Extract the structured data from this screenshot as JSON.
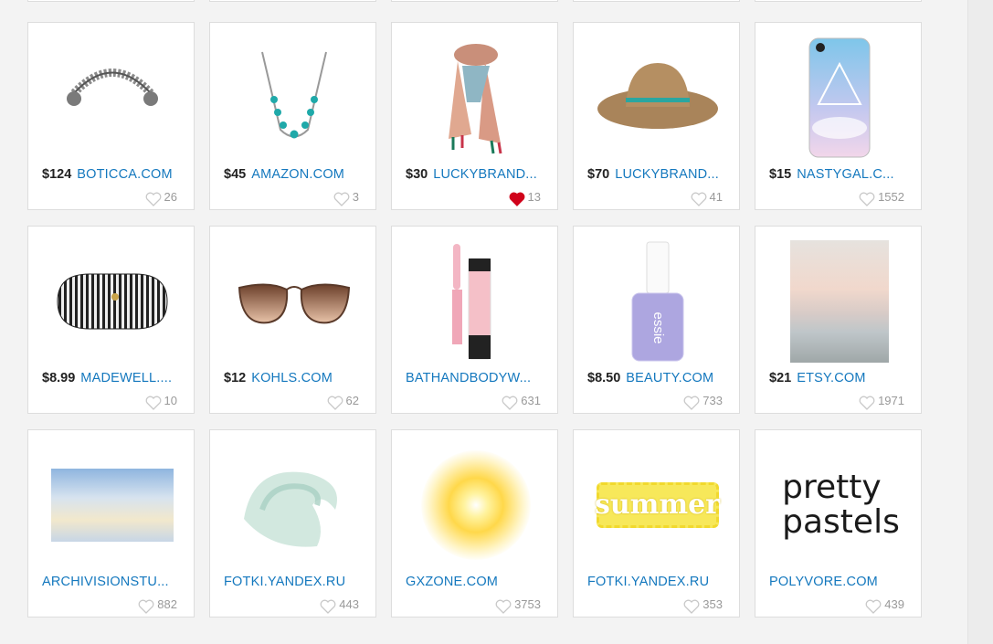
{
  "rows": [
    [
      {
        "price": "$124",
        "store": "BOTICCA.COM",
        "likes": "26",
        "liked": false,
        "icon": "silver-cuff-bracelet"
      },
      {
        "price": "$45",
        "store": "AMAZON.COM",
        "likes": "3",
        "liked": false,
        "icon": "turquoise-necklace"
      },
      {
        "price": "$30",
        "store": "LUCKYBRAND...",
        "likes": "13",
        "liked": true,
        "icon": "printed-scarf"
      },
      {
        "price": "$70",
        "store": "LUCKYBRAND...",
        "likes": "41",
        "liked": false,
        "icon": "straw-sun-hat"
      },
      {
        "price": "$15",
        "store": "NASTYGAL.C...",
        "likes": "1552",
        "liked": false,
        "icon": "pastel-phone-case"
      }
    ],
    [
      {
        "price": "$8.99",
        "store": "MADEWELL....",
        "likes": "10",
        "liked": false,
        "icon": "striped-glasses-case"
      },
      {
        "price": "$12",
        "store": "KOHLS.COM",
        "likes": "62",
        "liked": false,
        "icon": "aviator-sunglasses"
      },
      {
        "price": "",
        "store": "BATHANDBODYW...",
        "likes": "631",
        "liked": false,
        "icon": "pink-lip-gloss"
      },
      {
        "price": "$8.50",
        "store": "BEAUTY.COM",
        "likes": "733",
        "liked": false,
        "icon": "lavender-nail-polish"
      },
      {
        "price": "$21",
        "store": "ETSY.COM",
        "likes": "1971",
        "liked": false,
        "icon": "pastel-beach-print"
      }
    ],
    [
      {
        "price": "",
        "store": "ARCHIVISIONSTU...",
        "likes": "882",
        "liked": false,
        "icon": "cloud-painting"
      },
      {
        "price": "",
        "store": "FOTKI.YANDEX.RU",
        "likes": "443",
        "liked": false,
        "icon": "watercolor-wave"
      },
      {
        "price": "",
        "store": "GXZONE.COM",
        "likes": "3753",
        "liked": false,
        "icon": "sun-burst"
      },
      {
        "price": "",
        "store": "FOTKI.YANDEX.RU",
        "likes": "353",
        "liked": false,
        "icon": "summer-patch"
      },
      {
        "price": "",
        "store": "POLYVORE.COM",
        "likes": "439",
        "liked": false,
        "icon": "pretty-pastels-text"
      }
    ]
  ],
  "pretty_pastels_line1": "pretty",
  "pretty_pastels_line2": "pastels",
  "summer_text": "summer",
  "colors": {
    "accent": "#1478be",
    "liked": "#d0021b",
    "like_outline": "#c8c8c8"
  }
}
